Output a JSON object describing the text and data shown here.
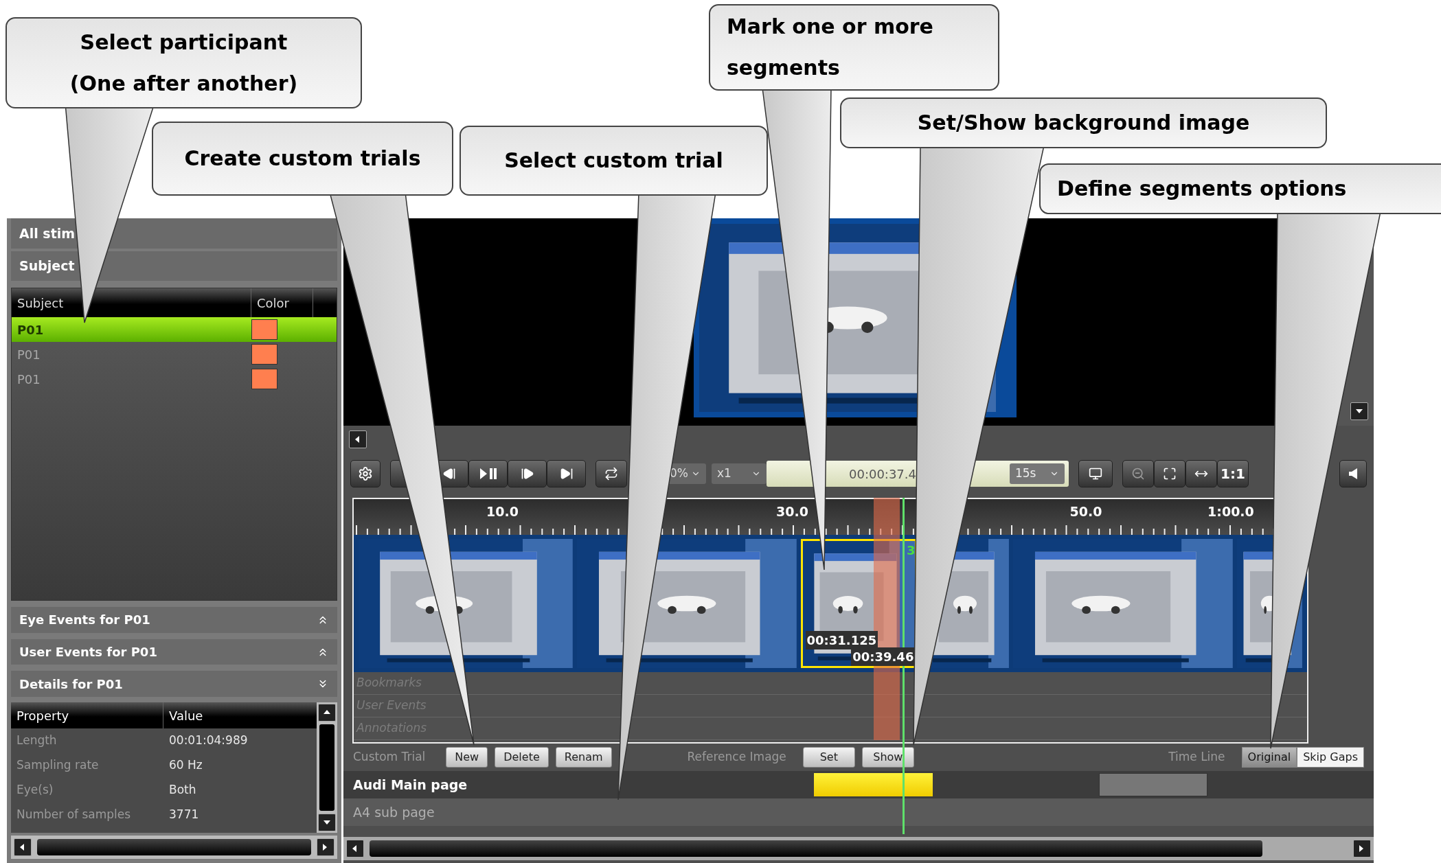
{
  "callouts": [
    {
      "lines": [
        "Select participant",
        "(One after another)"
      ]
    },
    {
      "lines": [
        "Create custom trials"
      ]
    },
    {
      "lines": [
        "Select custom trial"
      ]
    },
    {
      "lines": [
        "Mark one or more",
        "segments"
      ]
    },
    {
      "lines": [
        "Set/Show background image"
      ]
    },
    {
      "lines": [
        "Define segments options"
      ]
    }
  ],
  "left_panel": {
    "stimuli_header": "All stim",
    "subject_header": "Subject",
    "subjects": {
      "columns": [
        "Subject",
        "Color"
      ],
      "rows": [
        {
          "name": "P01",
          "color": "#ff7f4f",
          "selected": true
        },
        {
          "name": "P01",
          "color": "#ff7f4f",
          "selected": false
        },
        {
          "name": "P01",
          "color": "#ff7f4f",
          "selected": false
        }
      ]
    },
    "sections": [
      {
        "title": "Eye Events for P01",
        "expanded": false
      },
      {
        "title": "User Events for P01",
        "expanded": false
      },
      {
        "title": "Details for P01",
        "expanded": true
      }
    ],
    "details": {
      "columns": [
        "Property",
        "Value"
      ],
      "rows": [
        {
          "property": "Length",
          "value": "00:01:04:989"
        },
        {
          "property": "Sampling rate",
          "value": "60 Hz"
        },
        {
          "property": "Eye(s)",
          "value": "Both"
        },
        {
          "property": "Number of samples",
          "value": "3771"
        }
      ]
    }
  },
  "toolbar": {
    "zoom": "0%",
    "speed": "x1",
    "time": "00:00:37.4",
    "interval": "15s",
    "ratio": "1:1"
  },
  "timeline": {
    "ruler_labels": [
      "10.0",
      "30.0",
      "50.0",
      "1:00.0"
    ],
    "segment": {
      "marker": "3",
      "start": "00:31.125",
      "end": "00:39.46"
    },
    "tracks": [
      "Bookmarks",
      "User Events",
      "Annotations"
    ]
  },
  "bottom_bar": {
    "custom_trial": {
      "label": "Custom Trial",
      "buttons": [
        "New",
        "Delete",
        "Renam"
      ]
    },
    "reference_image": {
      "label": "Reference Image",
      "buttons": [
        "Set",
        "Show"
      ]
    },
    "time_line": {
      "label": "Time Line",
      "options": [
        {
          "label": "Original",
          "selected": true
        },
        {
          "label": "Skip Gaps",
          "selected": false
        }
      ]
    }
  },
  "trials": [
    {
      "name": "Audi Main page",
      "selected": true
    },
    {
      "name": "A4 sub page",
      "selected": false
    }
  ]
}
